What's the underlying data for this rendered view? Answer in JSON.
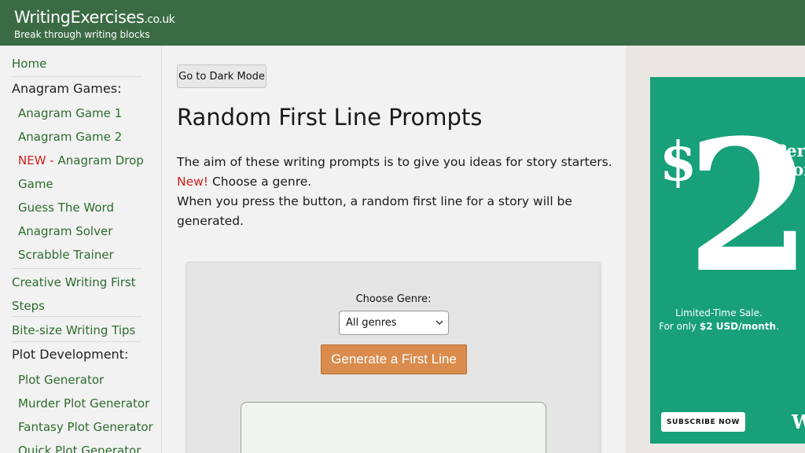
{
  "header": {
    "logo_main": "WritingExercises",
    "logo_domain": ".co.uk",
    "tagline": "Break through writing blocks"
  },
  "sidebar": {
    "items": [
      {
        "label": "Home",
        "type": "link"
      },
      {
        "label": "Anagram Games:",
        "type": "heading"
      },
      {
        "label": "Anagram Game 1",
        "type": "sublink"
      },
      {
        "label": "Anagram Game 2",
        "type": "sublink"
      },
      {
        "label_new": "NEW -",
        "label": " Anagram Drop",
        "type": "sublink"
      },
      {
        "label": "Game",
        "type": "sublink"
      },
      {
        "label": "Guess The Word",
        "type": "sublink"
      },
      {
        "label": "Anagram Solver",
        "type": "sublink"
      },
      {
        "label": "Scrabble Trainer",
        "type": "sublink"
      },
      {
        "label": "Creative Writing First",
        "type": "link"
      },
      {
        "label": "Steps",
        "type": "link"
      },
      {
        "label": "Bite-size Writing Tips",
        "type": "link"
      },
      {
        "label": "Plot Development:",
        "type": "heading"
      },
      {
        "label": "Plot Generator",
        "type": "sublink"
      },
      {
        "label": "Murder Plot Generator",
        "type": "sublink"
      },
      {
        "label": "Fantasy Plot Generator",
        "type": "sublink"
      },
      {
        "label": "Quick Plot Generator",
        "type": "sublink"
      }
    ]
  },
  "main": {
    "dark_mode_label": "Go to Dark Mode",
    "title": "Random First Line Prompts",
    "intro_line1": "The aim of these writing prompts is to give you ideas for story starters.",
    "intro_new": "New!",
    "intro_line2": " Choose a genre.",
    "intro_line3": "When you press the button, a random first line for a story will be generated.",
    "genre_label": "Choose Genre:",
    "genre_selected": "All genres",
    "generate_label": "Generate a First Line"
  },
  "ad": {
    "dollar": "$",
    "amount": "2",
    "per_line1": "Per",
    "per_line2": "Mon",
    "sale_line1": "Limited-Time Sale.",
    "sale_line2_prefix": "For only ",
    "sale_line2_bold": "$2 USD/month",
    "sale_line2_suffix": ".",
    "subscribe_label": "SUBSCRIBE NOW",
    "brand_letter": "W",
    "background_color": "#17a07a"
  },
  "colors": {
    "header_bg": "#3b6b44",
    "link_green": "#2e6b2e",
    "new_red": "#d21e1e",
    "button_orange": "#d98c4d"
  }
}
